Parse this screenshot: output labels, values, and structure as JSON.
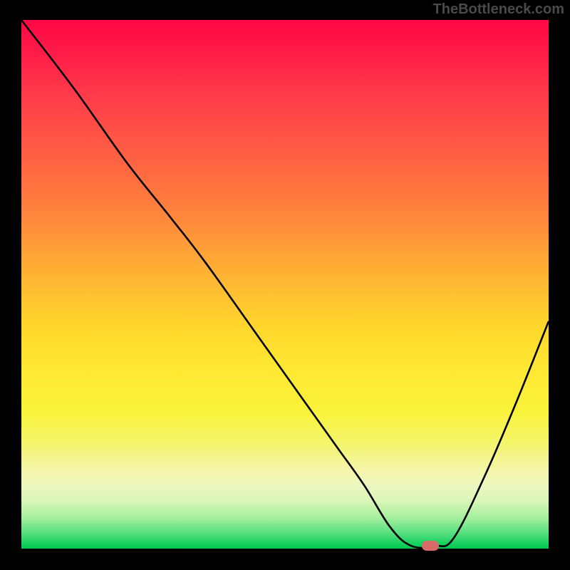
{
  "watermark": "TheBottleneck.com",
  "chart_data": {
    "type": "line",
    "title": "",
    "xlabel": "",
    "ylabel": "",
    "xlim": [
      0,
      100
    ],
    "ylim": [
      0,
      100
    ],
    "grid": false,
    "legend": false,
    "series": [
      {
        "name": "curve",
        "x": [
          0,
          10,
          20,
          28,
          35,
          45,
          55,
          60,
          65,
          70,
          74,
          78.5,
          82,
          88,
          94,
          100
        ],
        "y": [
          100,
          87,
          73,
          63,
          54,
          40,
          26,
          19,
          12,
          4,
          0.5,
          0.5,
          2,
          14,
          28,
          43
        ]
      }
    ],
    "marker": {
      "x": 77.5,
      "y": 0.5,
      "shape": "pill",
      "color": "#d86a6a"
    },
    "background_gradient": {
      "top": "#ff0844",
      "mid": "#ffd62c",
      "bottom": "#00c850"
    }
  }
}
